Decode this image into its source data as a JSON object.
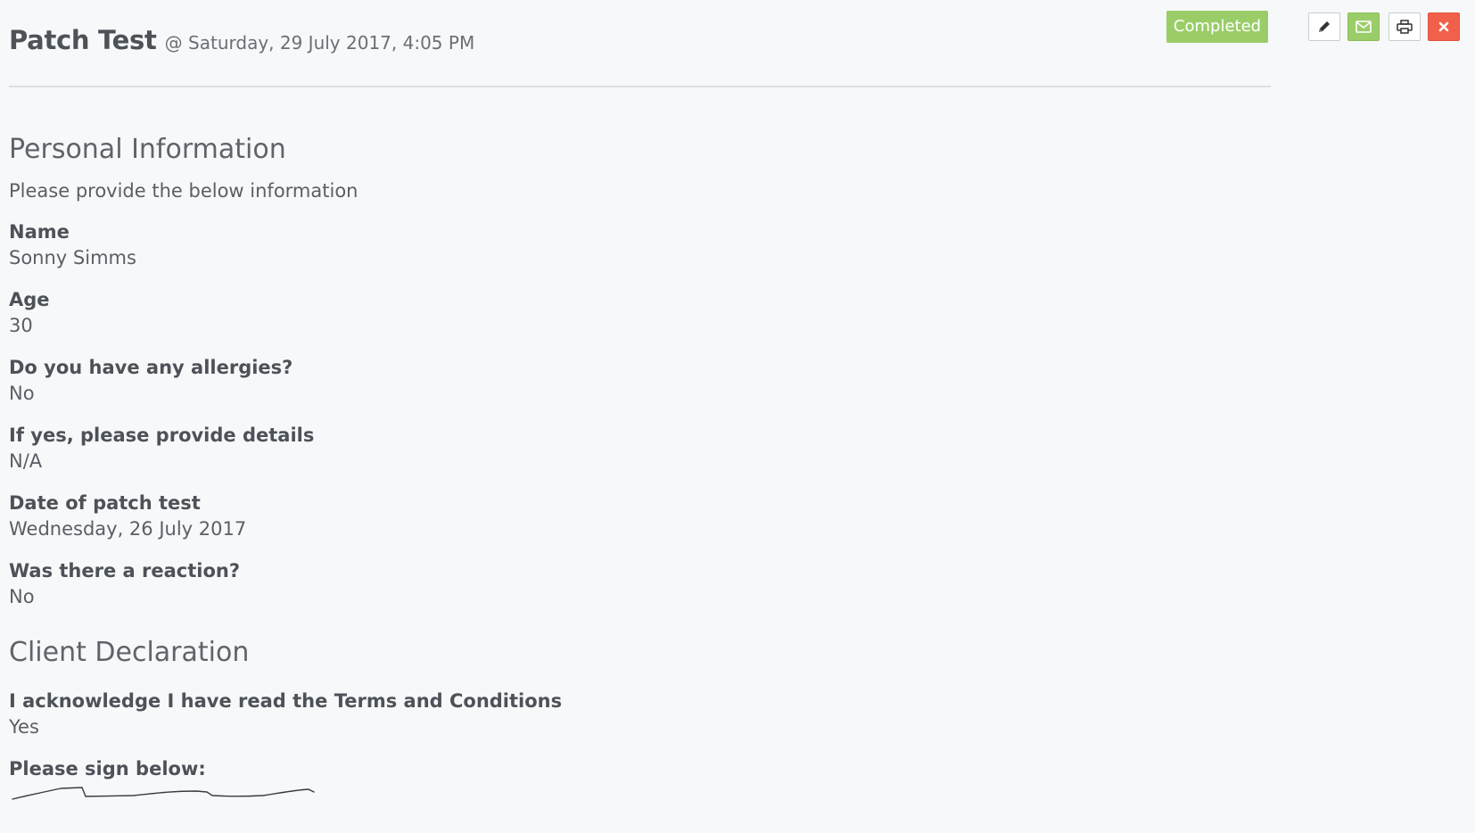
{
  "header": {
    "title": "Patch Test",
    "subtitle": "@ Saturday, 29 July 2017, 4:05 PM"
  },
  "status": {
    "label": "Completed",
    "color": "#9acd68"
  },
  "toolbar": {
    "edit_icon": "pencil-icon",
    "email_icon": "envelope-icon",
    "print_icon": "printer-icon",
    "close_icon": "close-icon"
  },
  "sections": {
    "personal": {
      "title": "Personal Information",
      "intro": "Please provide the below information",
      "fields": [
        {
          "label": "Name",
          "value": "Sonny Simms"
        },
        {
          "label": "Age",
          "value": "30"
        },
        {
          "label": "Do you have any allergies?",
          "value": "No"
        },
        {
          "label": "If yes, please provide details",
          "value": "N/A"
        },
        {
          "label": "Date of patch test",
          "value": "Wednesday, 26 July 2017"
        },
        {
          "label": "Was there a reaction?",
          "value": "No"
        }
      ]
    },
    "declaration": {
      "title": "Client Declaration",
      "fields": [
        {
          "label": "I acknowledge I have read the Terms and Conditions",
          "value": "Yes"
        }
      ],
      "signature_label": "Please sign below:"
    }
  }
}
